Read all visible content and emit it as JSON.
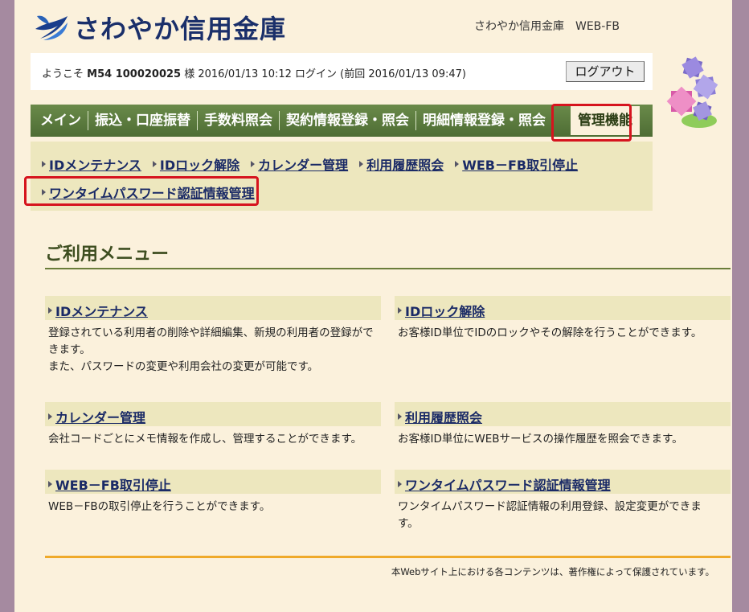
{
  "header": {
    "logo_text": "さわやか信用金庫",
    "site_name": "さわやか信用金庫　WEB-FB"
  },
  "welcome": {
    "prefix": "ようこそ ",
    "user_id": "M54 100020025",
    "suffix": " 様  2016/01/13 10:12 ログイン (前回  2016/01/13 09:47)",
    "logout_label": "ログアウト"
  },
  "nav": {
    "items": [
      "メイン",
      "振込・口座振替",
      "手数料照会",
      "契約情報登録・照会",
      "明細情報登録・照会"
    ],
    "active": "管理機能"
  },
  "subnav": {
    "links": [
      "IDメンテナンス",
      "IDロック解除",
      "カレンダー管理",
      "利用履歴照会",
      "WEB－FB取引停止",
      "ワンタイムパスワード認証情報管理"
    ]
  },
  "menu": {
    "title": "ご利用メニュー",
    "cards": [
      {
        "title": "IDメンテナンス",
        "desc": "登録されている利用者の削除や詳細編集、新規の利用者の登録ができます。\nまた、パスワードの変更や利用会社の変更が可能です。"
      },
      {
        "title": "IDロック解除",
        "desc": "お客様ID単位でIDのロックやその解除を行うことができます。"
      },
      {
        "title": "カレンダー管理",
        "desc": "会社コードごとにメモ情報を作成し、管理することができます。"
      },
      {
        "title": "利用履歴照会",
        "desc": "お客様ID単位にWEBサービスの操作履歴を照会できます。"
      },
      {
        "title": "WEB－FB取引停止",
        "desc": "WEB－FBの取引停止を行うことができます。"
      },
      {
        "title": "ワンタイムパスワード認証情報管理",
        "desc": "ワンタイムパスワード認証情報の利用登録、設定変更ができます。"
      }
    ]
  },
  "footer": {
    "copyright": "本Webサイト上における各コンテンツは、著作権によって保護されています。"
  },
  "colors": {
    "nav_green": "#5a7a3e",
    "highlight_red": "#d6141e",
    "footer_orange": "#efaa2a",
    "link_navy": "#1a2a66"
  }
}
